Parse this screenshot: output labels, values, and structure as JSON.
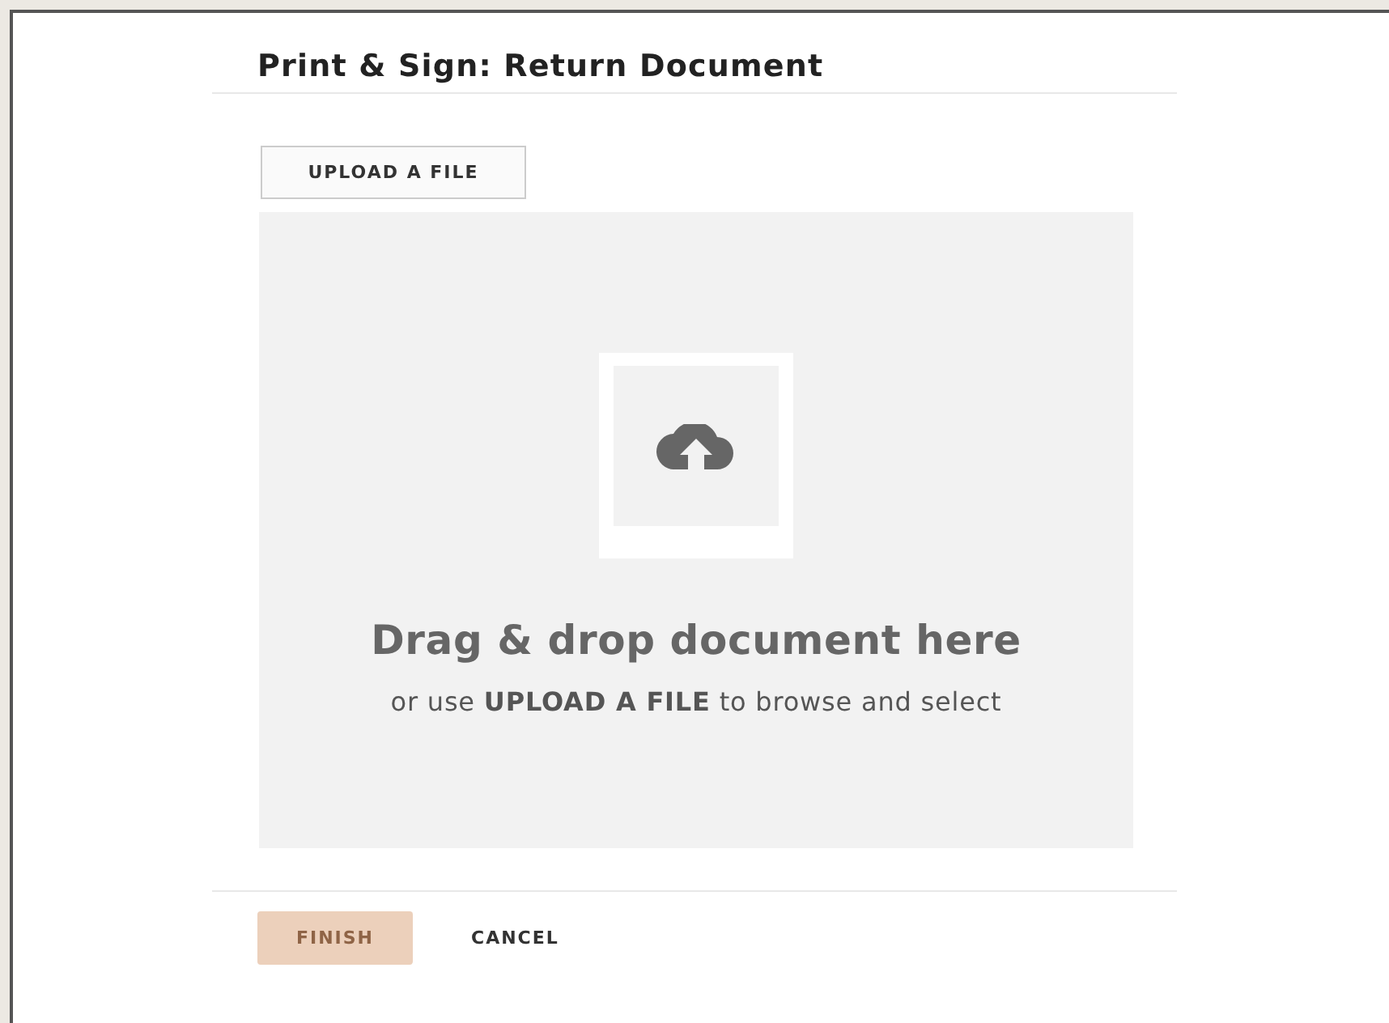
{
  "dialog": {
    "title": "Print & Sign: Return Document"
  },
  "upload_button": {
    "label": "UPLOAD A FILE"
  },
  "drop_zone": {
    "heading": "Drag & drop document here",
    "hint": "or use **UPLOAD A FILE** to browse and select"
  },
  "footer": {
    "buttons": [
      {
        "label": "FINISH",
        "kind": "primary",
        "disabled": true
      },
      {
        "label": "CANCEL",
        "kind": "text",
        "disabled": false
      }
    ]
  }
}
